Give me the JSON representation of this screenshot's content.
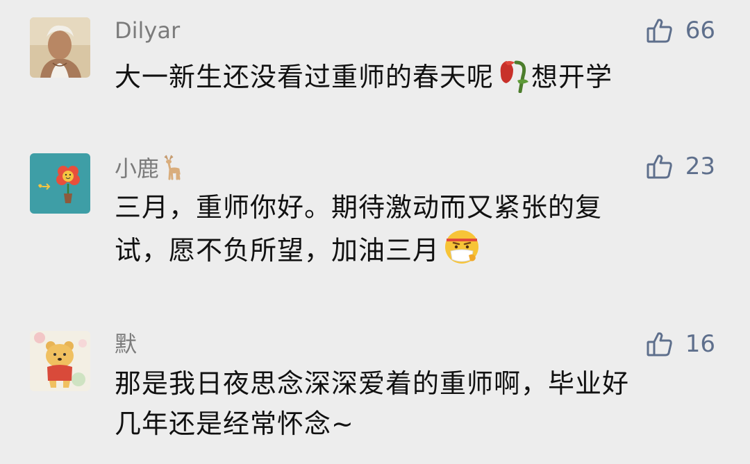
{
  "comments": [
    {
      "name": "Dilyar",
      "likes": "66",
      "text_before": "大一新生还没看过重师的春天呢",
      "emoji": "wilted-rose-icon",
      "text_after": "想开学"
    },
    {
      "name": "小鹿",
      "name_emoji": "deer-icon",
      "likes": "23",
      "text_line1": "三月，重师你好。期待激动而又紧张的复",
      "text_line2": "试，愿不负所望，加油三月",
      "emoji": "mask-face-icon"
    },
    {
      "name": "默",
      "likes": "16",
      "text_line1": "那是我日夜思念深深爱着的重师啊，毕业好",
      "text_line2": "几年还是经常怀念~"
    }
  ],
  "colors": {
    "background": "#ededed",
    "name": "#7b7b7b",
    "like_count": "#5e6f8c",
    "text": "#111111"
  }
}
